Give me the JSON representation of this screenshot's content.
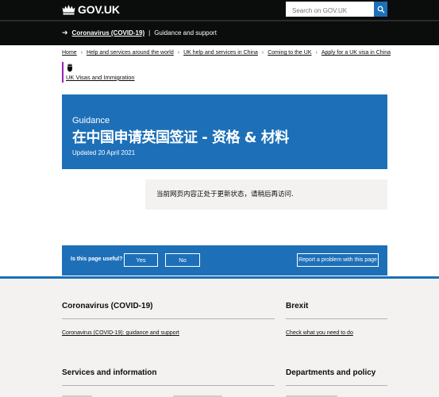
{
  "header": {
    "logo_text": "GOV.UK",
    "search_placeholder": "Search on GOV.UK"
  },
  "covid_banner": {
    "link": "Coronavirus (COVID-19)",
    "separator": "|",
    "text": "Guidance and support"
  },
  "breadcrumb": [
    "Home",
    "Help and services around the world",
    "UK help and services in China",
    "Coming to the UK",
    "Apply for a UK visa in China"
  ],
  "organisation": {
    "name": "UK Visas and Immigration"
  },
  "hero": {
    "type": "Guidance",
    "title": "在中国申请英国签证 - 资格 & 材料",
    "updated": "Updated 20 April 2021"
  },
  "notice": {
    "text": "当前网页内容正处于更新状态，请稍后再访问."
  },
  "feedback": {
    "question": "Is this page useful?",
    "yes": "Yes",
    "no": "No",
    "report": "Report a problem with this page"
  },
  "footer": {
    "sections": [
      {
        "heading": "Coronavirus (COVID-19)",
        "link": "Coronavirus (COVID-19): guidance and support"
      },
      {
        "heading": "Brexit",
        "link": "Check what you need to do"
      },
      {
        "heading": "Services and information"
      },
      {
        "heading": "Departments and policy"
      }
    ]
  },
  "colors": {
    "header": "#0b0c0c",
    "brand_blue": "#1d70b8",
    "footer_bg": "#f3f2f1",
    "org_rule": "#9325b2"
  }
}
